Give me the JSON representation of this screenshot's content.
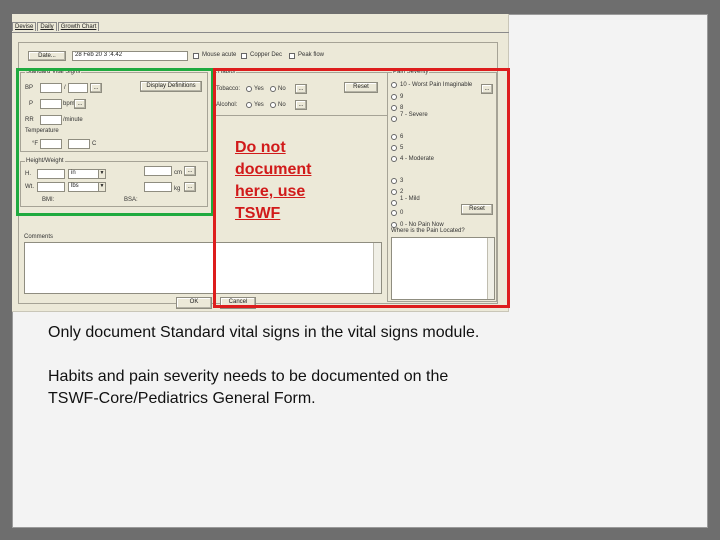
{
  "tabs": [
    "Devise",
    "Daily",
    "Growth Chart"
  ],
  "header": {
    "date_label": "Date...",
    "date_value": "28 Feb 20 3 :4.42",
    "checkboxes": [
      "Mouse acute",
      "Copper Dec",
      "Peak flow"
    ]
  },
  "vitals": {
    "group_title": "Standard Vital Signs",
    "bp_label": "BP",
    "bp_sep": "/",
    "pulse_label": "P",
    "pulse_unit": "bpm",
    "rr_label": "RR",
    "rr_unit": "/minute",
    "temp_title": "Temperature",
    "temp_unit_c": "C",
    "display_button": "Display Definitions",
    "hw_title": "Height/Weight",
    "height_label": "H.",
    "height_unit": "in",
    "weight_label": "Wt.",
    "weight_unit": "lbs",
    "height_conv_unit": "cm",
    "weight_conv_unit": "kg",
    "bmi_left": "BMI:",
    "bmi_right": "BSA:"
  },
  "habits": {
    "group_title": "Habits",
    "tobacco_label": "Tobacco:",
    "alcohol_label": "Alcohol:",
    "yes": "Yes",
    "no": "No",
    "reset_button": "Reset"
  },
  "pain": {
    "group_title": "Pain Severity",
    "scale": [
      "10 - Worst Pain Imaginable",
      "9",
      "8",
      "7 - Severe",
      "6",
      "5",
      "4 - Moderate",
      "3",
      "2",
      "1 - Mild",
      "0",
      "0 - No Pain Now"
    ],
    "reset_button": "Reset",
    "location_label": "Where is the Pain Located?"
  },
  "comments_label": "Comments",
  "ok_button": "OK",
  "cancel_button": "Cancel",
  "warning": "Do not document here, use TSWF",
  "body": {
    "line1": "Only document Standard vital signs in the vital signs module.",
    "line2a": "Habits and pain severity needs to be documented on the",
    "line2b": "TSWF-Core/Pediatrics General Form."
  }
}
